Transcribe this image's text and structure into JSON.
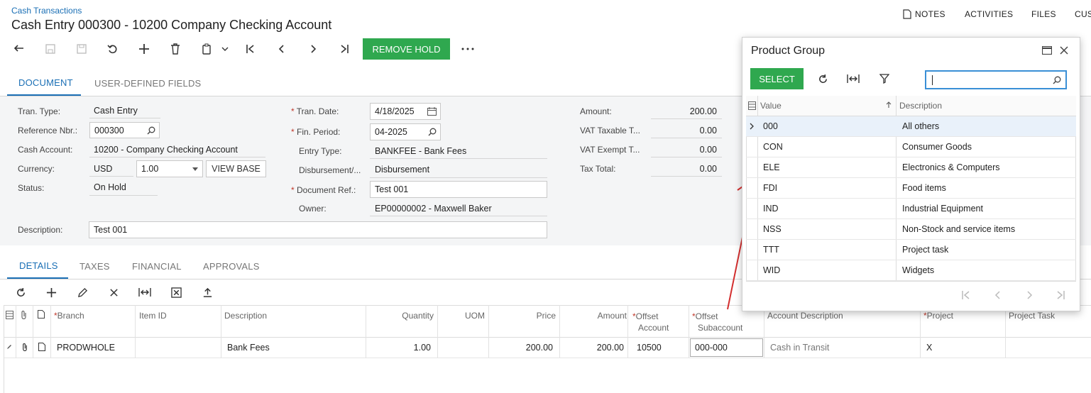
{
  "breadcrumb": "Cash Transactions",
  "page_title": "Cash Entry 000300 - 10200 Company Checking Account",
  "top_nav": {
    "notes": "NOTES",
    "activities": "ACTIVITIES",
    "files": "FILES",
    "customization": "CUS"
  },
  "toolbar": {
    "remove_hold": "REMOVE HOLD"
  },
  "tabs": {
    "document": "DOCUMENT",
    "user_defined": "USER-DEFINED FIELDS"
  },
  "form": {
    "tran_type_label": "Tran. Type:",
    "tran_type": "Cash Entry",
    "ref_nbr_label": "Reference Nbr.:",
    "ref_nbr": "000300",
    "cash_account_label": "Cash Account:",
    "cash_account": "10200 - Company Checking Account",
    "currency_label": "Currency:",
    "currency": "USD",
    "rate": "1.00",
    "view_base": "VIEW BASE",
    "status_label": "Status:",
    "status": "On Hold",
    "description_label": "Description:",
    "description": "Test 001",
    "tran_date_label": "Tran. Date:",
    "tran_date": "4/18/2025",
    "fin_period_label": "Fin. Period:",
    "fin_period": "04-2025",
    "entry_type_label": "Entry Type:",
    "entry_type": "BANKFEE - Bank Fees",
    "disbursement_label": "Disbursement/...",
    "disbursement": "Disbursement",
    "doc_ref_label": "Document Ref.:",
    "doc_ref": "Test 001",
    "owner_label": "Owner:",
    "owner": "EP00000002 - Maxwell Baker",
    "amount_label": "Amount:",
    "amount": "200.00",
    "vat_taxable_label": "VAT Taxable T...",
    "vat_taxable": "0.00",
    "vat_exempt_label": "VAT Exempt T...",
    "vat_exempt": "0.00",
    "tax_total_label": "Tax Total:",
    "tax_total": "0.00"
  },
  "detail_tabs": {
    "details": "DETAILS",
    "taxes": "TAXES",
    "financial": "FINANCIAL",
    "approvals": "APPROVALS"
  },
  "grid": {
    "headers": {
      "branch": "Branch",
      "item_id": "Item ID",
      "description": "Description",
      "quantity": "Quantity",
      "uom": "UOM",
      "price": "Price",
      "amount": "Amount",
      "offset_account_1": "Offset",
      "offset_account_2": "Account",
      "offset_sub_1": "Offset",
      "offset_sub_2": "Subaccount",
      "account_description": "Account Description",
      "project": "Project",
      "project_task": "Project Task"
    },
    "row": {
      "branch": "PRODWHOLE",
      "description": "Bank Fees",
      "quantity": "1.00",
      "price": "200.00",
      "amount": "200.00",
      "offset_account": "10500",
      "offset_sub": "000-000",
      "account_description": "Cash in Transit",
      "project": "X"
    }
  },
  "popup": {
    "title": "Product Group",
    "select": "SELECT",
    "search_value": "",
    "col_value": "Value",
    "col_description": "Description",
    "rows": [
      {
        "value": "000",
        "description": "All others"
      },
      {
        "value": "CON",
        "description": "Consumer Goods"
      },
      {
        "value": "ELE",
        "description": "Electronics & Computers"
      },
      {
        "value": "FDI",
        "description": "Food items"
      },
      {
        "value": "IND",
        "description": "Industrial Equipment"
      },
      {
        "value": "NSS",
        "description": "Non-Stock and service items"
      },
      {
        "value": "TTT",
        "description": "Project task"
      },
      {
        "value": "WID",
        "description": "Widgets"
      }
    ]
  },
  "colors": {
    "accent": "#1a6fb5",
    "success": "#2fa84f",
    "annotation": "#d32f2f"
  }
}
